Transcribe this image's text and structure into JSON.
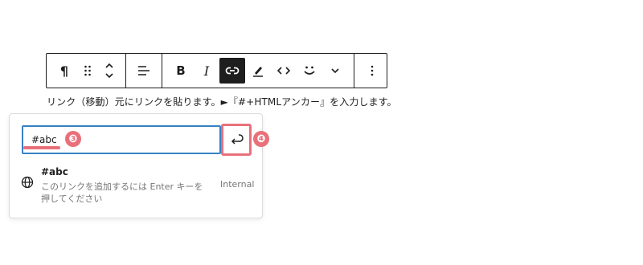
{
  "toolbar": {
    "buttons": {
      "paragraph": "¶",
      "bold": "B",
      "italic": "I"
    }
  },
  "caption": "リンク（移動）元にリンクを貼ります。►『#+HTMLアンカー』を入力します。",
  "link_popover": {
    "url_value": "#abc",
    "annotations": [
      "❸",
      "❹"
    ],
    "suggestion": {
      "title": "#abc",
      "description": "このリンクを追加するには Enter キーを押してください",
      "type": "Internal"
    }
  },
  "colors": {
    "accent": "#e9707a",
    "focus": "#3582c4",
    "active_button": "#1e1e1e"
  }
}
